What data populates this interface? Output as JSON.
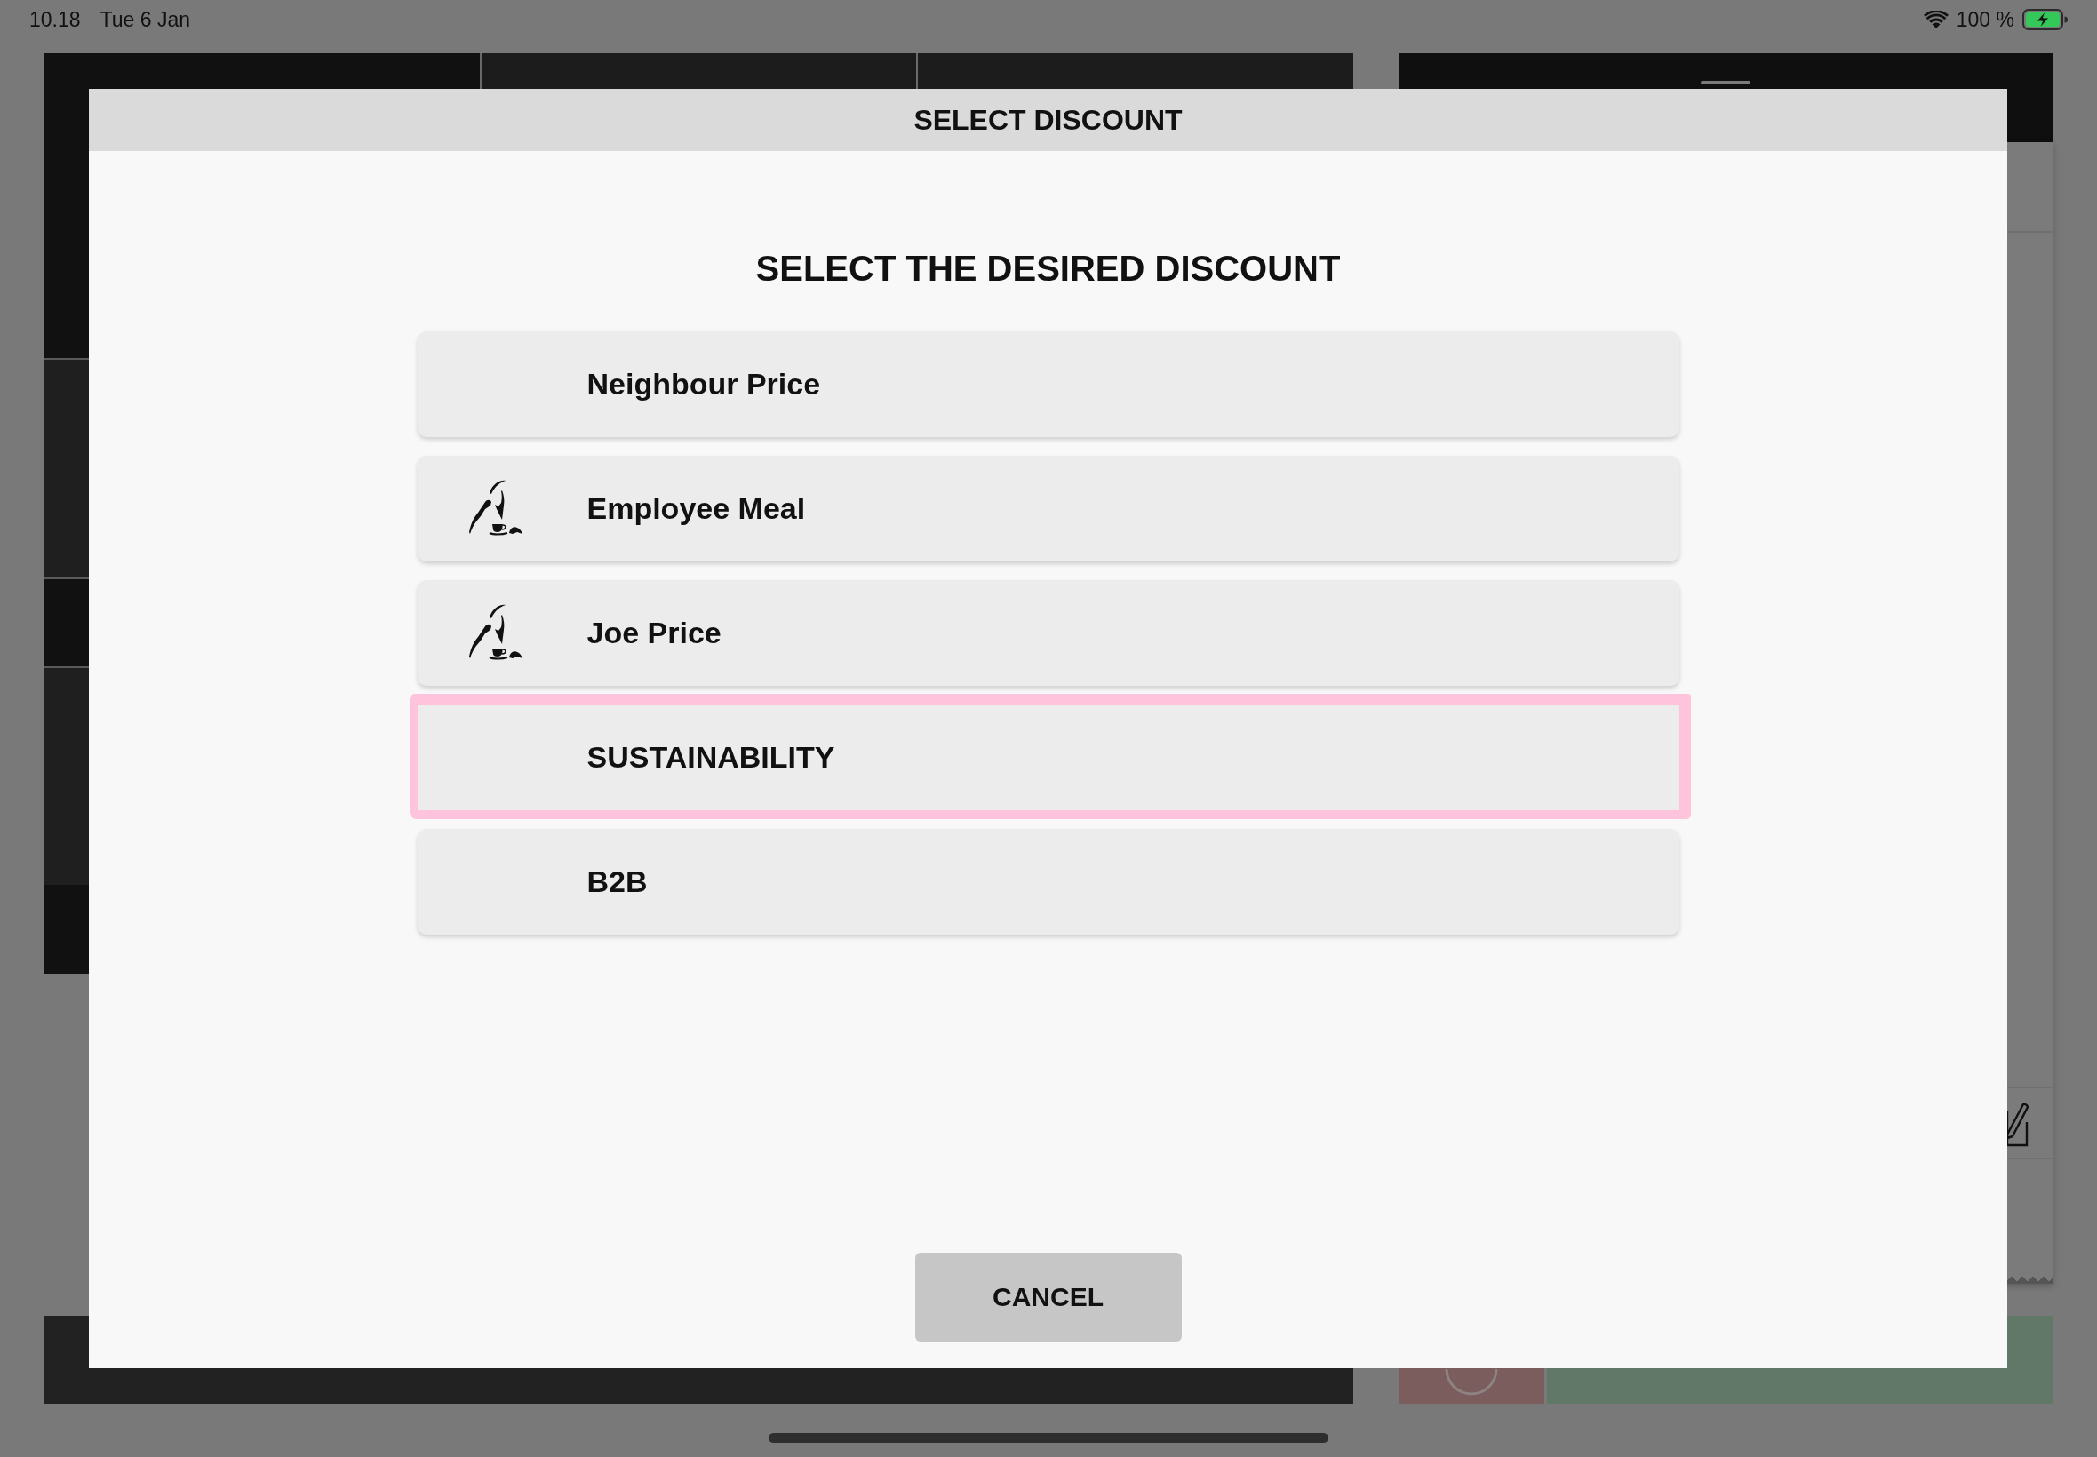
{
  "status_bar": {
    "time": "10.18",
    "date": "Tue 6 Jan",
    "battery": "100 %"
  },
  "dialog": {
    "title": "SELECT DISCOUNT",
    "heading": "SELECT THE DESIRED DISCOUNT",
    "options": [
      {
        "label": "Neighbour Price",
        "icon": false,
        "highlighted": false
      },
      {
        "label": "Employee Meal",
        "icon": true,
        "highlighted": false
      },
      {
        "label": "Joe Price",
        "icon": true,
        "highlighted": false
      },
      {
        "label": "SUSTAINABILITY",
        "icon": false,
        "highlighted": true
      },
      {
        "label": "B2B",
        "icon": false,
        "highlighted": false
      }
    ],
    "cancel_button": "CANCEL"
  }
}
